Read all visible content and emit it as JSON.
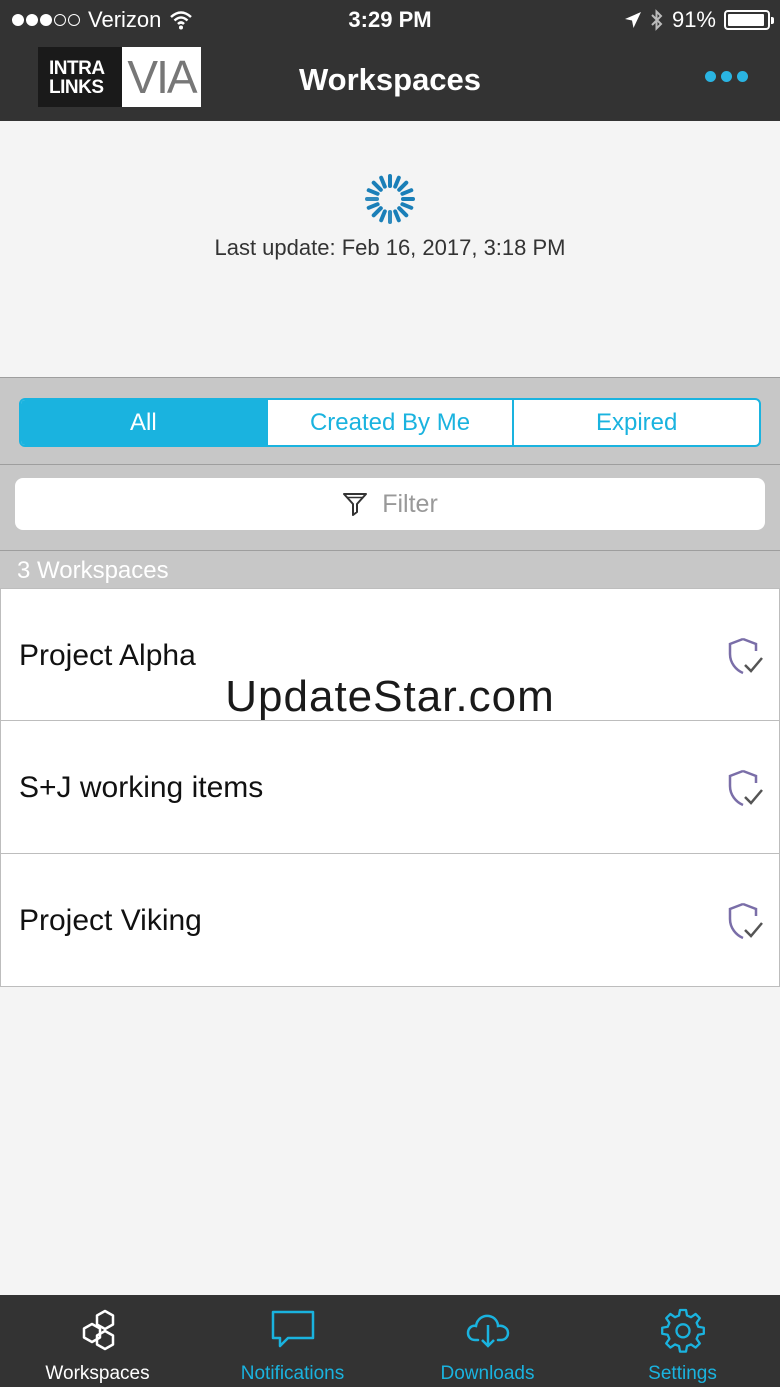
{
  "status_bar": {
    "carrier": "Verizon",
    "time": "3:29 PM",
    "battery": "91%"
  },
  "nav": {
    "logo_intra": "INTRA LINKS",
    "logo_via": "VIA",
    "title": "Workspaces"
  },
  "refresh": {
    "last_update": "Last update: Feb 16, 2017, 3:18 PM"
  },
  "segments": {
    "all": "All",
    "created_by_me": "Created By Me",
    "expired": "Expired"
  },
  "filter": {
    "placeholder": "Filter"
  },
  "list": {
    "header": "3 Workspaces",
    "items": [
      {
        "name": "Project Alpha"
      },
      {
        "name": "S+J working items"
      },
      {
        "name": "Project Viking"
      }
    ]
  },
  "watermark": "UpdateStar.com",
  "tabs": {
    "workspaces": "Workspaces",
    "notifications": "Notifications",
    "downloads": "Downloads",
    "settings": "Settings"
  },
  "colors": {
    "accent": "#1ab3df",
    "bar": "#333333",
    "shield": "#7a6ea8"
  }
}
